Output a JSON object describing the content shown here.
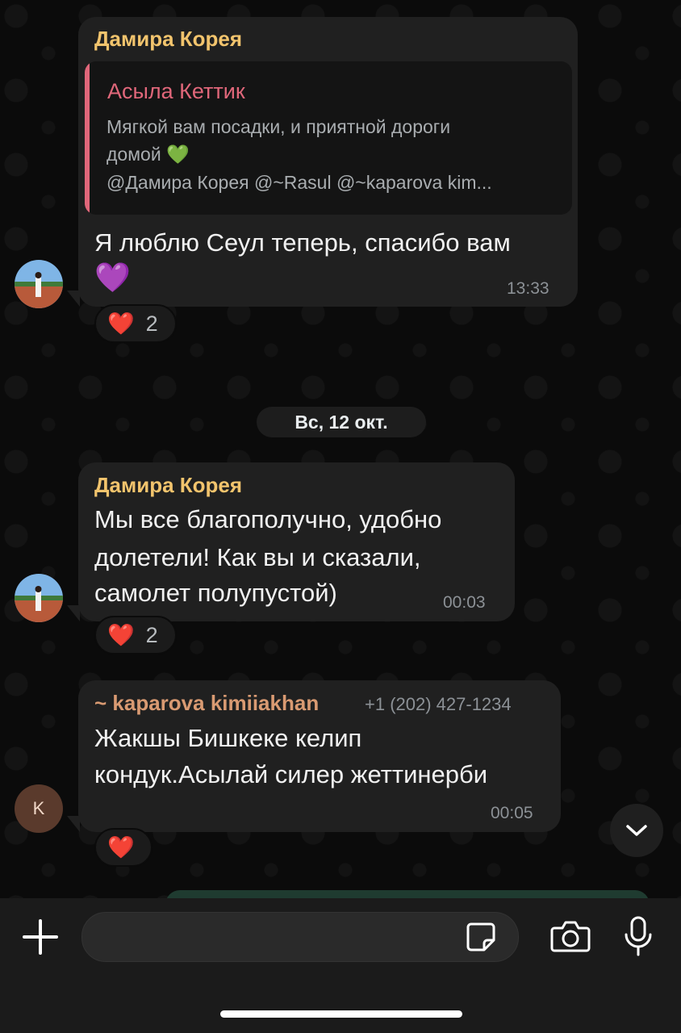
{
  "messages": [
    {
      "sender": "Дамира Корея",
      "sender_color": "#f2c46d",
      "reply": {
        "author": "Асыла Кеттик",
        "author_color": "#e0677a",
        "line1": "Мягкой вам посадки, и приятной дороги",
        "line2": "домой 💚",
        "line3": "@Дамира Корея @~Rasul @~kaparova kim..."
      },
      "text_line1": "Я люблю Сеул теперь, спасибо вам",
      "text_line2": "💜",
      "time": "13:33",
      "reaction_emoji": "❤️",
      "reaction_count": "2"
    },
    {
      "sender": "Дамира Корея",
      "sender_color": "#f2c46d",
      "text_line1": "Мы все благополучно, удобно",
      "text_line2": "долетели! Как вы и сказали,",
      "text_line3": "самолет полупустой)",
      "time": "00:03",
      "reaction_emoji": "❤️",
      "reaction_count": "2"
    },
    {
      "sender": "~ kaparova kimiiakhan",
      "sender_color": "#d99a72",
      "phone": "+1 (202) 427-1234",
      "avatar_letter": "K",
      "text_line1": "Жакшы Бишкеке келип",
      "text_line2": "кондук.Асылай силер жеттинерби",
      "time": "00:05",
      "reaction_emoji": "❤️"
    }
  ],
  "date_divider": "Вс, 12 окт.",
  "composer": {
    "input_value": "",
    "icons": [
      "plus-icon",
      "sticker-icon",
      "camera-icon",
      "microphone-icon"
    ]
  },
  "scroll_down_icon": "chevron-down-icon"
}
